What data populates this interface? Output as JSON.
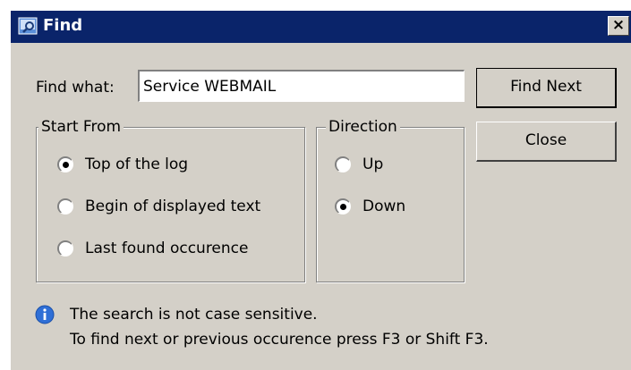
{
  "window": {
    "title": "Find",
    "close_glyph": "×"
  },
  "find": {
    "label": "Find what:",
    "value": "Service WEBMAIL"
  },
  "buttons": {
    "find_next": "Find Next",
    "close": "Close"
  },
  "start_from": {
    "legend": "Start From",
    "options": [
      "Top of the log",
      "Begin of displayed text",
      "Last found occurence"
    ],
    "selected": "Top of the log"
  },
  "direction": {
    "legend": "Direction",
    "options": [
      "Up",
      "Down"
    ],
    "selected": "Down"
  },
  "info": {
    "line1": "The search is not case sensitive.",
    "line2": "To find next or previous occurence press F3 or Shift F3."
  },
  "icons": {
    "title_icon": "find-icon",
    "info_icon": "info-icon"
  },
  "colors": {
    "titlebar": "#0a246a",
    "dialog_bg": "#d4d0c8",
    "info_icon": "#2f6fd6"
  }
}
